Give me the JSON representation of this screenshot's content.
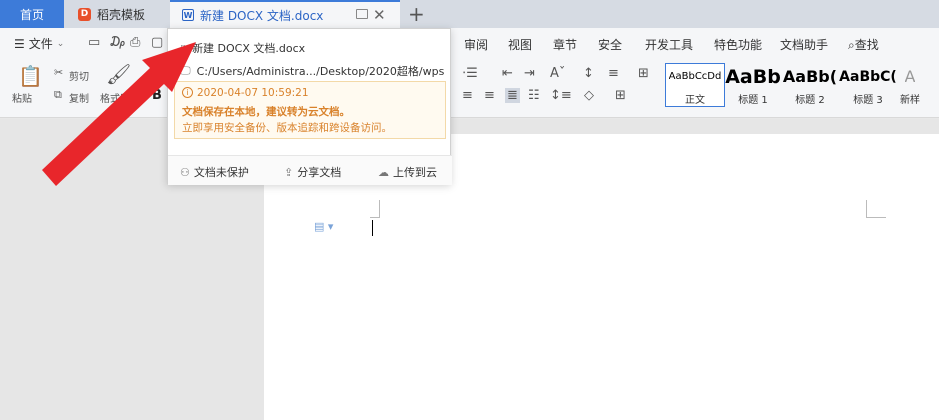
{
  "tabs": {
    "home": "首页",
    "templates": "稻壳模板",
    "document": "新建 DOCX 文档.docx",
    "add": "+",
    "close": "✕"
  },
  "menu": {
    "file": "文件",
    "items": [
      "审阅",
      "视图",
      "章节",
      "安全",
      "开发工具",
      "特色功能",
      "文档助手"
    ],
    "search": "查找"
  },
  "toolbar": {
    "paste": "粘贴",
    "cut": "剪切",
    "copy": "复制",
    "format_painter": "格式刷"
  },
  "styles": [
    {
      "sample": "AaBbCcDd",
      "name": "正文"
    },
    {
      "sample": "AaBb",
      "name": "标题 1"
    },
    {
      "sample": "AaBb(",
      "name": "标题 2"
    },
    {
      "sample": "AaBbC(",
      "name": "标题 3"
    },
    {
      "sample": "A",
      "name": "新样"
    }
  ],
  "popup": {
    "filename": "新建 DOCX 文档.docx",
    "path": "C:/Users/Administra.../Desktop/2020超格/wps",
    "timestamp": "2020-04-07 10:59:21",
    "warning_title": "文档保存在本地，建议转为云文档。",
    "warning_subtitle": "立即享用安全备份、版本追踪和跨设备访问。",
    "actions": {
      "unprotected": "文档未保护",
      "share": "分享文档",
      "upload": "上传到云"
    }
  },
  "colors": {
    "accent": "#3d7bd9",
    "warning": "#d9822b",
    "arrow": "#e8262b"
  }
}
